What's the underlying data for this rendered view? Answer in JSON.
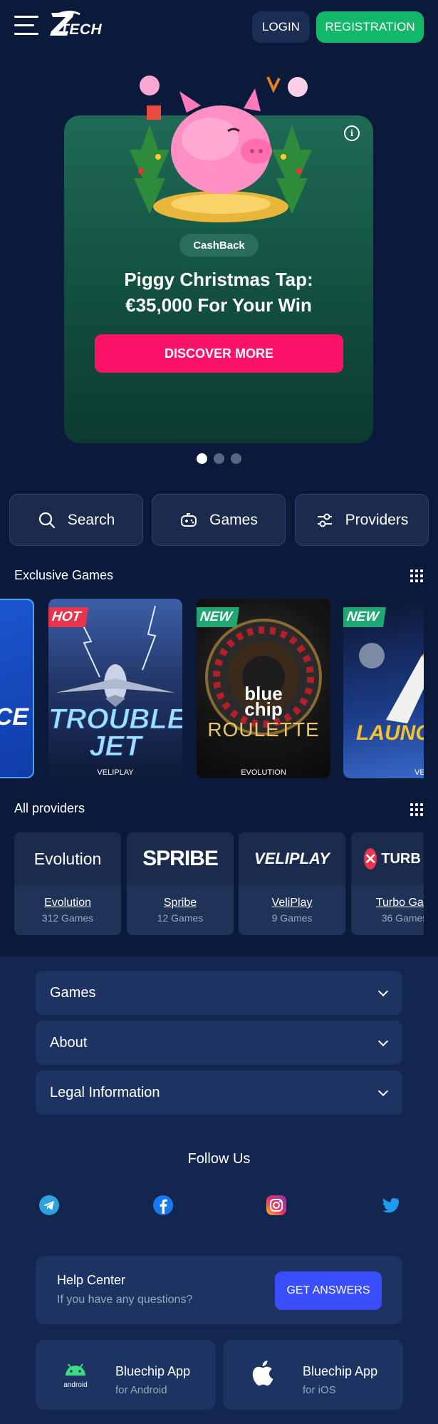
{
  "header": {
    "logo_text": "TECH",
    "login_label": "LOGIN",
    "registration_label": "REGISTRATION"
  },
  "banner": {
    "tag": "CashBack",
    "title_line1": "Piggy Christmas Tap:",
    "title_line2": "€35,000 For Your Win",
    "cta_label": "DISCOVER MORE",
    "info_icon": "info-icon",
    "slides": 3,
    "active_slide": 1
  },
  "quicknav": {
    "search_label": "Search",
    "games_label": "Games",
    "providers_label": "Providers"
  },
  "exclusive": {
    "title": "Exclusive Games",
    "games": [
      {
        "tag": "",
        "title": "CE",
        "provider": ""
      },
      {
        "tag": "HOT",
        "title": "TROUBLE JET",
        "provider": "VELIPLAY"
      },
      {
        "tag": "NEW",
        "title": "ROULETTE",
        "provider": "EVOLUTION"
      },
      {
        "tag": "NEW",
        "title": "LAUNC",
        "provider": "VELIPLAY"
      }
    ]
  },
  "providers": {
    "title": "All providers",
    "items": [
      {
        "name": "Evolution",
        "count": "312 Games",
        "logo": "Evolution"
      },
      {
        "name": "Spribe",
        "count": "12 Games",
        "logo": "SPRIBE"
      },
      {
        "name": "VeliPlay",
        "count": "9 Games",
        "logo": "VELIPLAY"
      },
      {
        "name": "Turbo Gam",
        "count": "36 Games",
        "logo": "TURB GAM"
      }
    ]
  },
  "footer": {
    "accordions": [
      "Games",
      "About",
      "Legal Information"
    ],
    "follow_title": "Follow Us",
    "social_icons": [
      "telegram-icon",
      "facebook-icon",
      "instagram-icon",
      "twitter-icon"
    ],
    "help_title": "Help Center",
    "help_sub": "If you have any questions?",
    "help_button": "GET ANSWERS",
    "apps": [
      {
        "title": "Bluechip App",
        "sub": "for Android",
        "icon": "android-icon",
        "icon_text": "android"
      },
      {
        "title": "Bluechip App",
        "sub": "for iOS",
        "icon": "apple-icon"
      }
    ]
  },
  "colors": {
    "background": "#0b1a3b",
    "registration": "#12b76a",
    "discover": "#fc1268",
    "help_button": "#3a4dff",
    "hot_tag": "#e8344d",
    "new_tag": "#1fa673"
  }
}
